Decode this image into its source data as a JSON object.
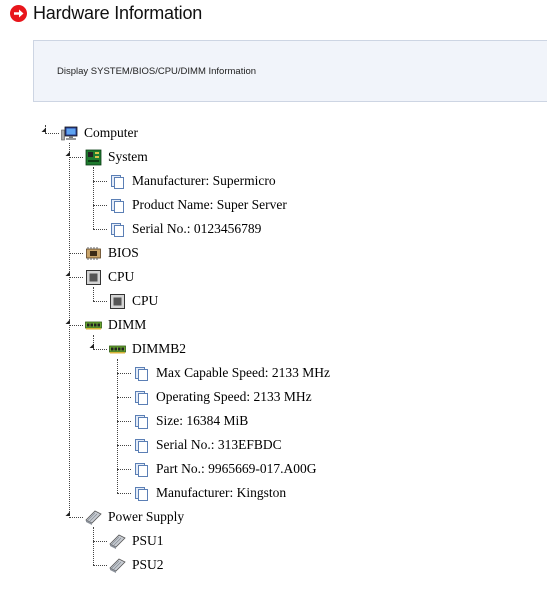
{
  "header": {
    "title": "Hardware Information",
    "icon": "arrow-right-circle-icon",
    "accent": "#e8151b"
  },
  "info": {
    "text": "Display SYSTEM/BIOS/CPU/DIMM Information"
  },
  "tree": {
    "computer": {
      "label": "Computer",
      "icon": "computer-icon"
    },
    "system": {
      "label": "System",
      "icon": "motherboard-icon",
      "items": [
        {
          "label": "Manufacturer: Supermicro",
          "icon": "document-icon"
        },
        {
          "label": "Product Name: Super Server",
          "icon": "document-icon"
        },
        {
          "label": "Serial No.: 0123456789",
          "icon": "document-icon"
        }
      ]
    },
    "bios": {
      "label": "BIOS",
      "icon": "chip-icon"
    },
    "cpu": {
      "label": "CPU",
      "icon": "cpu-icon",
      "items": [
        {
          "label": "CPU",
          "icon": "cpu-icon"
        }
      ]
    },
    "dimm": {
      "label": "DIMM",
      "icon": "memory-icon",
      "modules": [
        {
          "label": "DIMMB2",
          "icon": "memory-icon",
          "items": [
            {
              "label": "Max Capable Speed: 2133 MHz",
              "icon": "document-icon"
            },
            {
              "label": "Operating Speed: 2133 MHz",
              "icon": "document-icon"
            },
            {
              "label": "Size: 16384 MiB",
              "icon": "document-icon"
            },
            {
              "label": "Serial No.: 313EFBDC",
              "icon": "document-icon"
            },
            {
              "label": "Part No.: 9965669-017.A00G",
              "icon": "document-icon"
            },
            {
              "label": "Manufacturer: Kingston",
              "icon": "document-icon"
            }
          ]
        }
      ]
    },
    "power": {
      "label": "Power Supply",
      "icon": "power-supply-icon",
      "items": [
        {
          "label": "PSU1",
          "icon": "power-supply-icon"
        },
        {
          "label": "PSU2",
          "icon": "power-supply-icon"
        }
      ]
    }
  }
}
